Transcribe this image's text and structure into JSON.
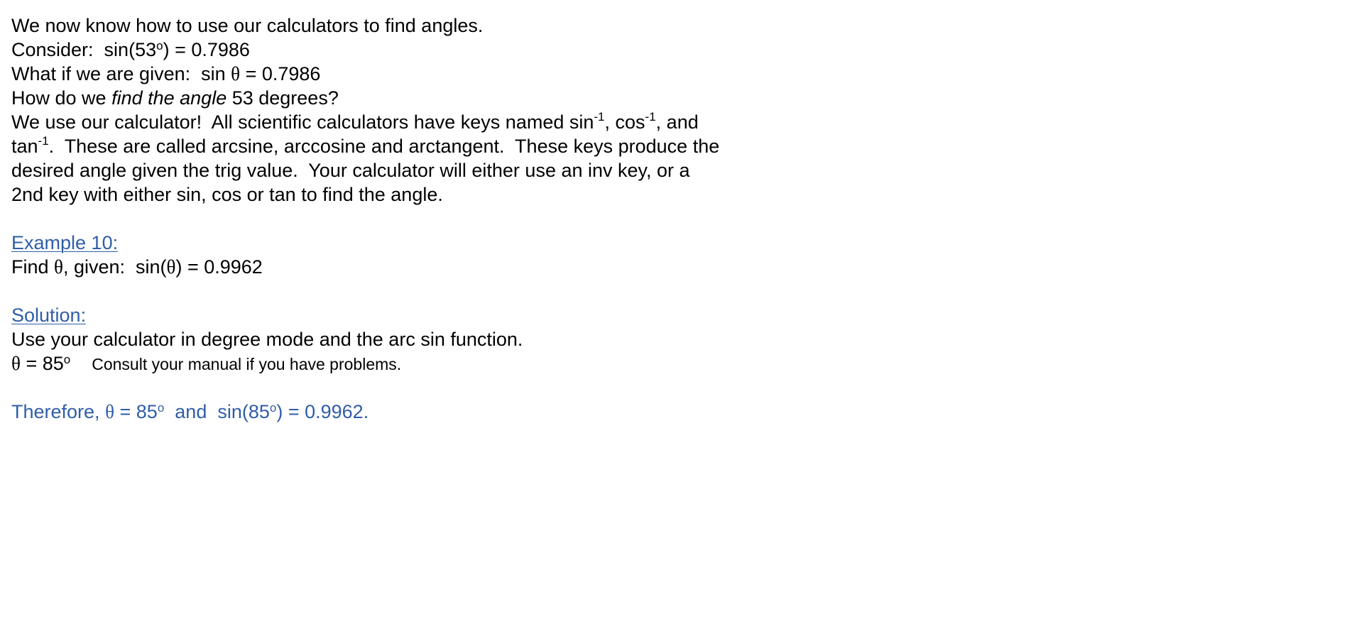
{
  "intro": {
    "line1": "We now know how to use our calculators to find angles.",
    "consider_prefix": "Consider:  sin(53",
    "consider_deg": "o",
    "consider_suffix": ") = 0.7986",
    "given_prefix": "What if we are given:  sin ",
    "given_theta": "θ",
    "given_suffix": " = 0.7986",
    "how_prefix": "How do we ",
    "how_italic": "find the angle",
    "how_suffix": " 53 degrees?",
    "para_l1_a": "We use our calculator!  All scientific calculators have keys named sin",
    "para_l1_sup1": "-1",
    "para_l1_b": ", cos",
    "para_l1_sup2": "-1",
    "para_l1_c": ", and",
    "para_l2_a": "tan",
    "para_l2_sup": "-1",
    "para_l2_b": ".  These are called arcsine, arccosine and arctangent.  These keys produce the",
    "para_l3": "desired angle given the trig value.  Your calculator will either use an inv key, or a",
    "para_l4": "2nd key with either sin, cos or tan to find the angle."
  },
  "example": {
    "heading": "Example 10:",
    "find_prefix": "Find ",
    "find_theta": "θ",
    "find_mid": ", given:  sin(",
    "find_theta2": "θ",
    "find_suffix": ") = 0.9962"
  },
  "solution": {
    "heading": "Solution:",
    "line1": "Use your calculator in degree mode and the arc sin function.",
    "theta": "θ",
    "result": " = 85",
    "result_deg": "o",
    "note": "Consult your manual if you have problems."
  },
  "conclusion": {
    "prefix": "Therefore, ",
    "theta": "θ",
    "mid": " = 85",
    "deg1": "o",
    "mid2": "  and  sin(85",
    "deg2": "o",
    "suffix": ") = 0.9962."
  }
}
